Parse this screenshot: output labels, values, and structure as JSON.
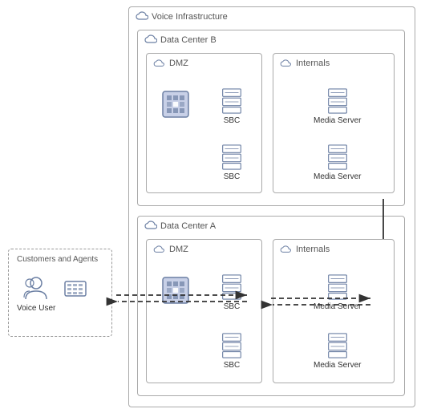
{
  "diagram": {
    "title": "Voice Infrastructure",
    "regions": {
      "voiceInfra": {
        "label": "Voice Infrastructure"
      },
      "dataCenterB": {
        "label": "Data Center B"
      },
      "dmzB": {
        "label": "DMZ"
      },
      "internalsB": {
        "label": "Internals"
      },
      "dataCenterA": {
        "label": "Data Center A"
      },
      "dmzA": {
        "label": "DMZ"
      },
      "internalsA": {
        "label": "Internals"
      },
      "customersBox": {
        "label": "Customers and Agents"
      }
    },
    "nodes": {
      "sbcB1": {
        "label": "SBC"
      },
      "sbcB2": {
        "label": "SBC"
      },
      "mediaServerB1": {
        "label": "Media Server"
      },
      "mediaServerB2": {
        "label": "Media Server"
      },
      "sbcA1": {
        "label": "SBC"
      },
      "sbcA2": {
        "label": "SBC"
      },
      "mediaServerA1": {
        "label": "Media Server"
      },
      "mediaServerA2": {
        "label": "Media Server"
      },
      "voiceUser": {
        "label": "Voice User"
      },
      "firewallB": {
        "label": ""
      },
      "firewallA": {
        "label": ""
      }
    }
  }
}
